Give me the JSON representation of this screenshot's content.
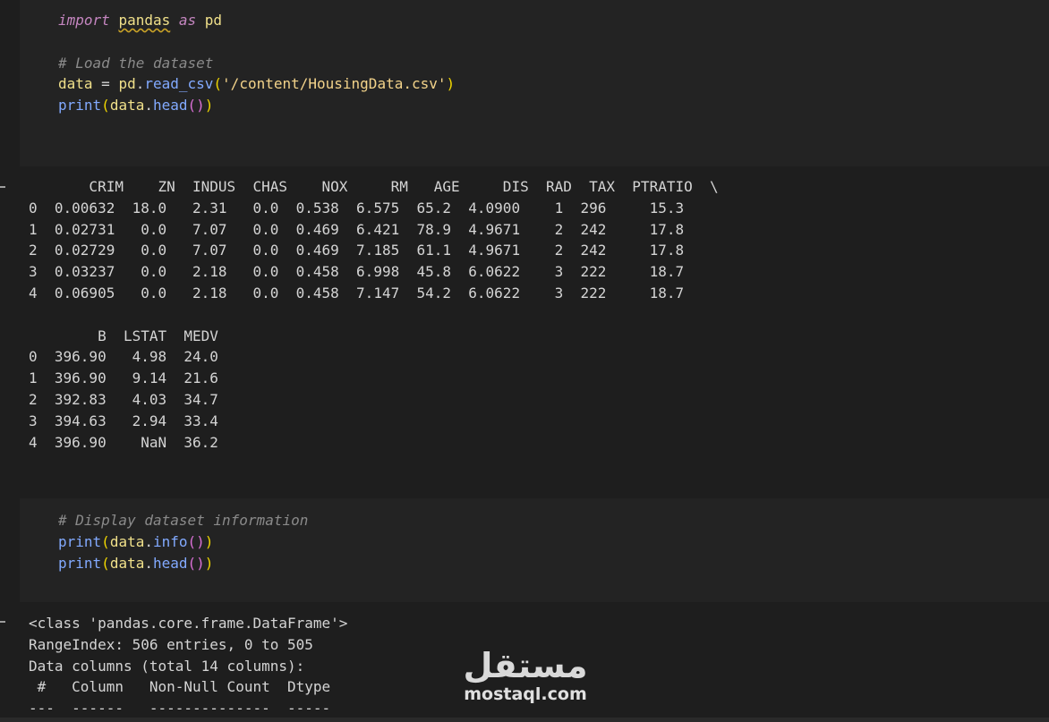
{
  "cell1": {
    "line1": {
      "kw1": "import",
      "mod": "pandas",
      "kw2": "as",
      "alias": "pd"
    },
    "comment": "# Load the dataset",
    "line3": {
      "var": "data",
      "eq": " = ",
      "obj": "pd",
      "fn": "read_csv",
      "path": "'/content/HousingData.csv'"
    },
    "line4": {
      "fn": "print",
      "obj": "data",
      "method": "head"
    }
  },
  "output1": {
    "header1": "       CRIM    ZN  INDUS  CHAS    NOX     RM   AGE     DIS  RAD  TAX  PTRATIO  \\",
    "rows1": [
      "0  0.00632  18.0   2.31   0.0  0.538  6.575  65.2  4.0900    1  296     15.3",
      "1  0.02731   0.0   7.07   0.0  0.469  6.421  78.9  4.9671    2  242     17.8",
      "2  0.02729   0.0   7.07   0.0  0.469  7.185  61.1  4.9671    2  242     17.8",
      "3  0.03237   0.0   2.18   0.0  0.458  6.998  45.8  6.0622    3  222     18.7",
      "4  0.06905   0.0   2.18   0.0  0.458  7.147  54.2  6.0622    3  222     18.7"
    ],
    "header2": "        B  LSTAT  MEDV",
    "rows2": [
      "0  396.90   4.98  24.0",
      "1  396.90   9.14  21.6",
      "2  392.83   4.03  34.7",
      "3  394.63   2.94  33.4",
      "4  396.90    NaN  36.2"
    ]
  },
  "cell2": {
    "comment": "# Display dataset information",
    "line2": {
      "fn": "print",
      "obj": "data",
      "method": "info"
    },
    "line3": {
      "fn": "print",
      "obj": "data",
      "method": "head"
    }
  },
  "output2": {
    "lines": [
      "<class 'pandas.core.frame.DataFrame'>",
      "RangeIndex: 506 entries, 0 to 505",
      "Data columns (total 14 columns):",
      " #   Column   Non-Null Count  Dtype",
      "---  ------   --------------  -----"
    ]
  },
  "watermark": {
    "arabic": "مستقل",
    "latin": "mostaql.com"
  }
}
